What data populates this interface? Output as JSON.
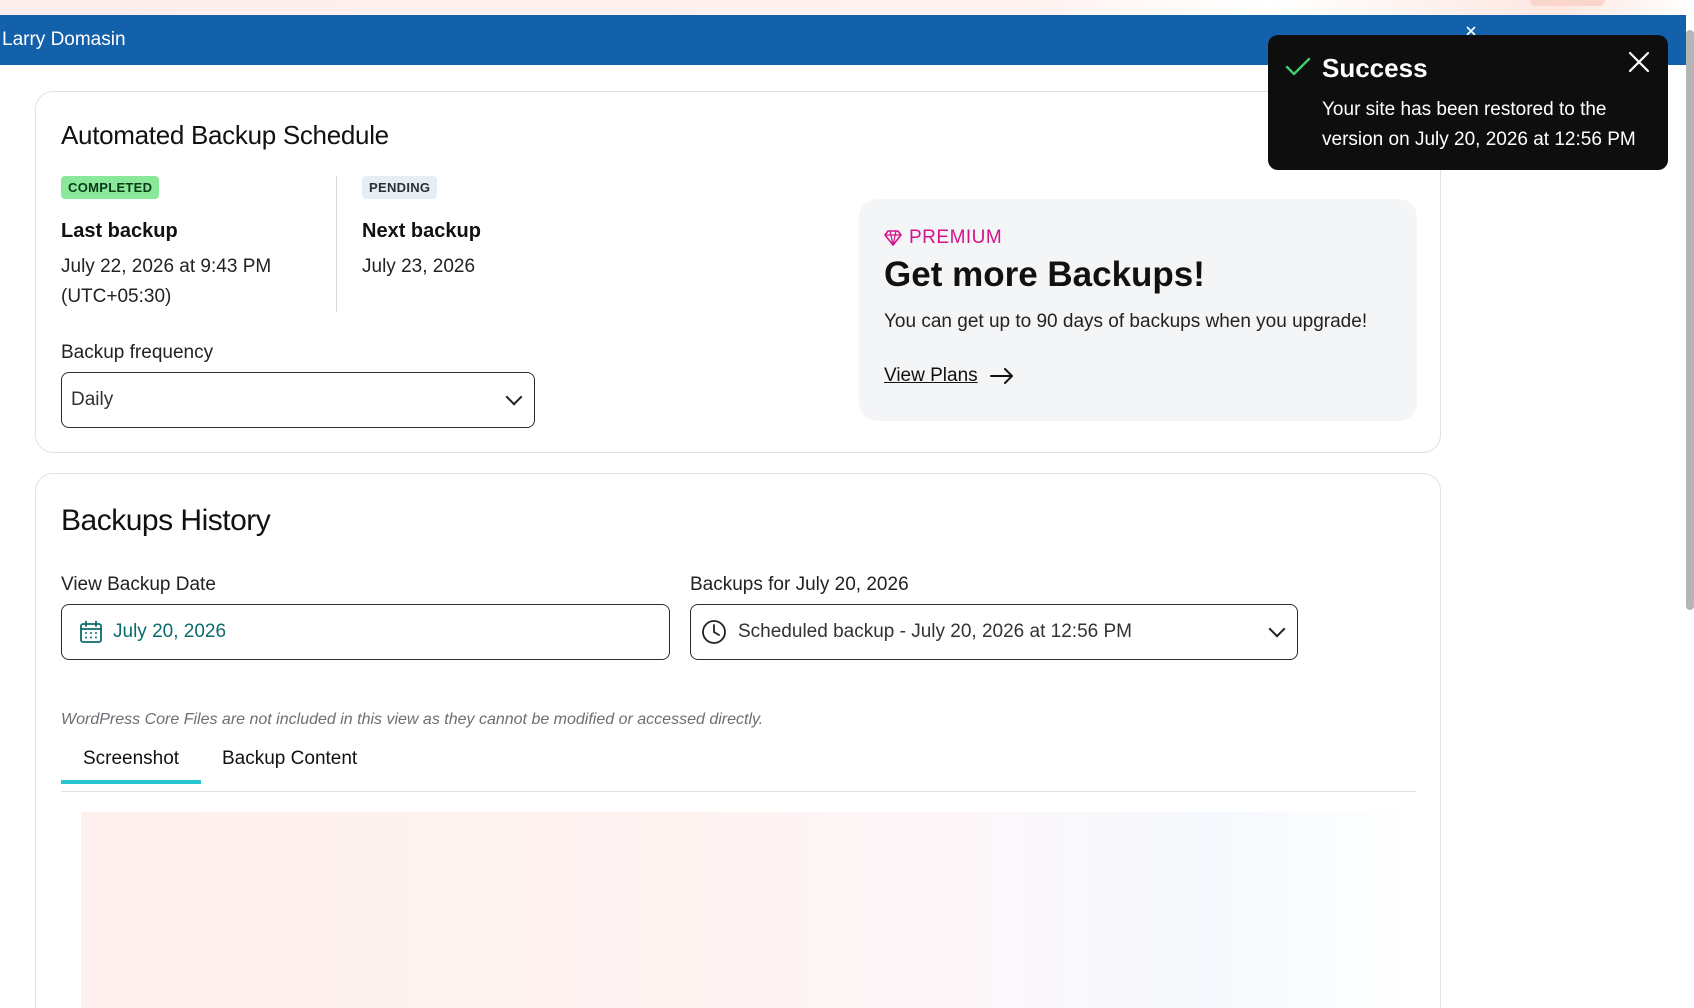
{
  "header": {
    "user_name": "Larry Domasin"
  },
  "schedule": {
    "title": "Automated Backup Schedule",
    "last": {
      "badge": "COMPLETED",
      "label": "Last backup",
      "value": "July 22, 2026 at 9:43 PM (UTC+05:30)"
    },
    "next": {
      "badge": "PENDING",
      "label": "Next backup",
      "value": "July 23, 2026"
    },
    "frequency": {
      "label": "Backup frequency",
      "value": "Daily"
    }
  },
  "premium": {
    "tag": "PREMIUM",
    "title": "Get more Backups!",
    "description": "You can get up to 90 days of backups when you upgrade!",
    "link_label": "View Plans"
  },
  "history": {
    "title": "Backups History",
    "date_label": "View Backup Date",
    "date_value": "July 20, 2026",
    "backups_for_label": "Backups for July 20, 2026",
    "backup_selected": "Scheduled backup - July 20, 2026 at 12:56 PM",
    "note": "WordPress Core Files are not included in this view as they cannot be modified or accessed directly.",
    "tabs": [
      {
        "label": "Screenshot",
        "active": true
      },
      {
        "label": "Backup Content",
        "active": false
      }
    ]
  },
  "toast": {
    "title": "Success",
    "message": "Your site has been restored to the version on July 20, 2026 at 12:56 PM"
  },
  "colors": {
    "header_bg": "#1461ab",
    "premium_accent": "#d4138b",
    "completed_badge": "#89e89a",
    "active_tab_underline": "#27c6d3",
    "date_text": "#0b6b6b",
    "toast_bg": "#0e0e0e",
    "toast_check": "#3fcf6a"
  },
  "icons": {
    "toast": [
      "check-icon",
      "close-icon"
    ],
    "premium": "diamond-icon",
    "link": "arrow-right-icon",
    "date": "calendar-icon",
    "backup": "clock-icon",
    "select": "chevron-down-icon"
  }
}
